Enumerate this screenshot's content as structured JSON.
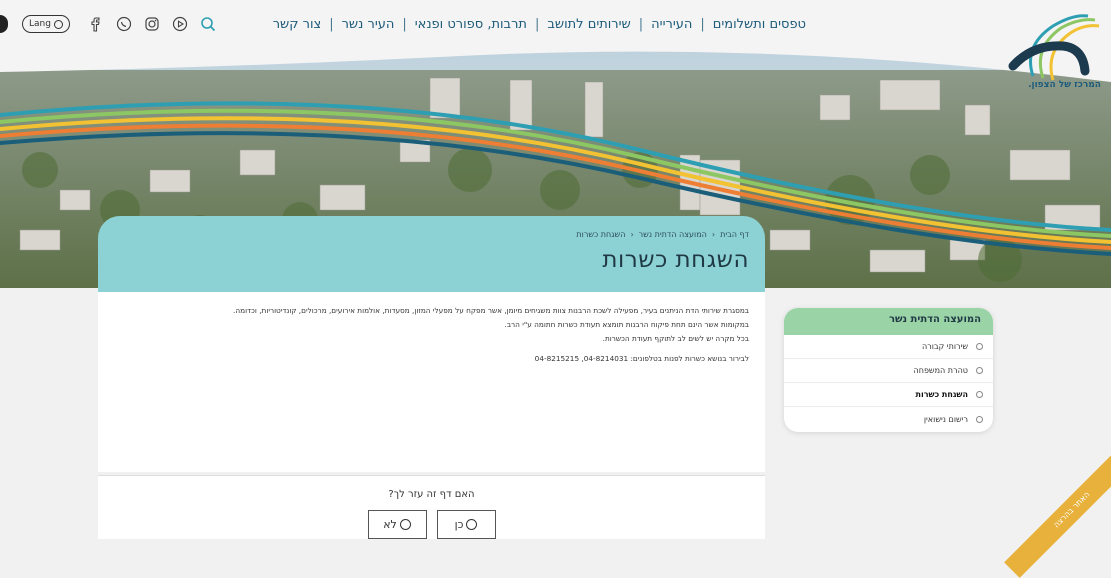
{
  "logo": {
    "tagline": "המרכז של הצפון."
  },
  "nav": {
    "items": [
      {
        "label": "טפסים ותשלומים"
      },
      {
        "label": "העירייה"
      },
      {
        "label": "שירותים לתושב"
      },
      {
        "label": "תרבות, ספורט ופנאי"
      },
      {
        "label": "העיר נשר"
      },
      {
        "label": "צור קשר"
      }
    ]
  },
  "toolbar": {
    "lang_label": "Lang"
  },
  "breadcrumb": {
    "home": "דף הבית",
    "section": "המועצה הדתית נשר",
    "current": "השגחת כשרות"
  },
  "page": {
    "title": "השגחת כשרות",
    "paragraphs": [
      "במסגרת שירותי הדת הניתנים בעיר, מפעילה לשכת הרבנות צוות משגיחים מיומן, אשר מפקח על מפעלי המזון, מסעדות, אולמות אירועים, מרכולים, קונדיטוריות, וכדומה.",
      "במקומות אשר הינם תחת פיקוח הרבנות תומצא תעודת כשרות חתומה ע\"י הרב.",
      "בכל מקרה יש לשים לב לתוקף תעודת הכשרות."
    ],
    "contact": "לבירור בנושא כשרות לפנות בטלפונים: 04-8214031, 04-8215215"
  },
  "feedback": {
    "question": "האם דף זה עזר לך?",
    "yes_label": "כן",
    "no_label": "לא"
  },
  "sidebar": {
    "title": "המועצה הדתית נשר",
    "items": [
      {
        "label": "שירותי קבורה",
        "active": false
      },
      {
        "label": "טהרת המשפחה",
        "active": false
      },
      {
        "label": "השגחת כשרות",
        "active": true
      },
      {
        "label": "רישום נישואין",
        "active": false
      }
    ]
  },
  "ribbon": {
    "label": "האתר בהרצה"
  },
  "colors": {
    "title_bg": "#8cd2d4",
    "sidebar_head": "#9ad3a6",
    "nav_text": "#1d5b7a",
    "ribbon": "#e8b13b"
  }
}
